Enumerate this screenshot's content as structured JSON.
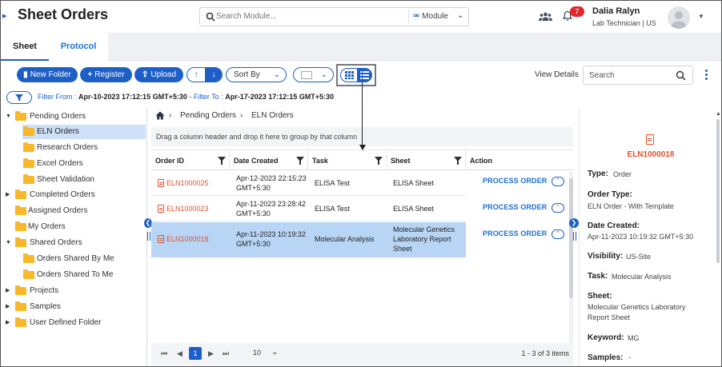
{
  "header": {
    "title": "Sheet Orders",
    "search_placeholder": "Search Module...",
    "module_label": "Module",
    "notification_count": "7",
    "user_name": "Dalia Ralyn",
    "user_role": "Lab Technician | US"
  },
  "tabs": [
    {
      "label": "Sheet",
      "active": true
    },
    {
      "label": "Protocol",
      "active": false
    }
  ],
  "toolbar": {
    "new_folder": "New Folder",
    "register": "Register",
    "upload": "Upload",
    "sort_by": "Sort By",
    "view_details": "View Details",
    "search_placeholder": "Search"
  },
  "filter": {
    "from_label": "Filter From :",
    "from_value": "Apr-10-2023 17:12:15 GMT+5:30",
    "sep": "-",
    "to_label": "Filter To :",
    "to_value": "Apr-17-2023 17:12:15 GMT+5:30"
  },
  "tree": [
    {
      "label": "Pending Orders",
      "level": 0,
      "expanded": true
    },
    {
      "label": "ELN Orders",
      "level": 1,
      "selected": true
    },
    {
      "label": "Research Orders",
      "level": 1
    },
    {
      "label": "Excel Orders",
      "level": 1
    },
    {
      "label": "Sheet Validation",
      "level": 1
    },
    {
      "label": "Completed Orders",
      "level": 0,
      "expanded": false
    },
    {
      "label": "Assigned Orders",
      "level": 0
    },
    {
      "label": "My Orders",
      "level": 0
    },
    {
      "label": "Shared Orders",
      "level": 0,
      "expanded": true
    },
    {
      "label": "Orders Shared By Me",
      "level": 1
    },
    {
      "label": "Orders Shared To Me",
      "level": 1
    },
    {
      "label": "Projects",
      "level": 0,
      "expanded": false
    },
    {
      "label": "Samples",
      "level": 0,
      "expanded": false
    },
    {
      "label": "User Defined Folder",
      "level": 0,
      "expanded": false
    }
  ],
  "breadcrumb": [
    "Pending Orders",
    "ELN Orders"
  ],
  "group_hint": "Drag a column header and drop it here to group by that column",
  "grid": {
    "columns": [
      "Order ID",
      "Date Created",
      "Task",
      "Sheet",
      "Action"
    ],
    "rows": [
      {
        "order_id": "ELN1000025",
        "date_l1": "Apr-12-2023 22:15:23",
        "date_l2": "GMT+5:30",
        "task": "ELISA Test",
        "sheet_l1": "ELISA Sheet",
        "sheet_l2": "",
        "sheet_l3": "",
        "action": "PROCESS ORDER",
        "selected": false
      },
      {
        "order_id": "ELN1000023",
        "date_l1": "Apr-11-2023 23:28:42",
        "date_l2": "GMT+5:30",
        "task": "ELISA Test",
        "sheet_l1": "ELISA Sheet",
        "sheet_l2": "",
        "sheet_l3": "",
        "action": "PROCESS ORDER",
        "selected": false
      },
      {
        "order_id": "ELN1000018",
        "date_l1": "Apr-11-2023 10:19:32",
        "date_l2": "GMT+5:30",
        "task": "Molecular Analysis",
        "sheet_l1": "Molecular Genetics",
        "sheet_l2": "Laboratory Report",
        "sheet_l3": "Sheet",
        "action": "PROCESS ORDER",
        "selected": true
      }
    ]
  },
  "pager": {
    "page": "1",
    "page_size": "10",
    "info": "1 - 3 of 3 items"
  },
  "details": {
    "order_id": "ELN1000018",
    "type_label": "Type:",
    "type_value": "Order",
    "order_type_label": "Order Type:",
    "order_type_value": "ELN Order - With Template",
    "date_label": "Date Created:",
    "date_value": "Apr-11-2023 10:19:32 GMT+5:30",
    "visibility_label": "Visibility:",
    "visibility_value": "US-Site",
    "task_label": "Task:",
    "task_value": "Molecular Analysis",
    "sheet_label": "Sheet:",
    "sheet_value_l1": "Molecular Genetics Laboratory",
    "sheet_value_l2": "Report Sheet",
    "keyword_label": "Keyword:",
    "keyword_value": "MG",
    "samples_label": "Samples:",
    "samples_value": "-"
  },
  "colors": {
    "primary": "#1d5fc7",
    "order_link": "#e2522c",
    "folder": "#f7b82a",
    "selected_row": "#b8d5f5",
    "badge": "#e0272f"
  }
}
